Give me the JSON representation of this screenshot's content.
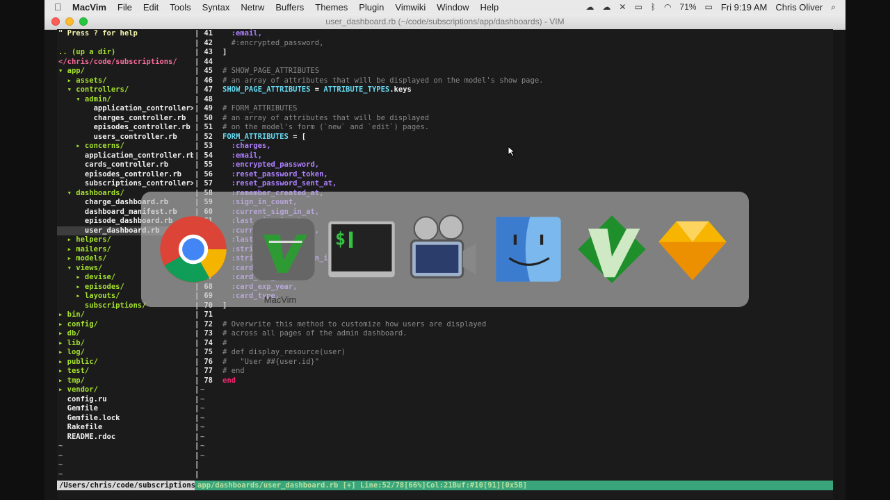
{
  "menubar": {
    "app_name": "MacVim",
    "items": [
      "File",
      "Edit",
      "Tools",
      "Syntax",
      "Netrw",
      "Buffers",
      "Themes",
      "Plugin",
      "Vimwiki",
      "Window",
      "Help"
    ],
    "battery": "71%",
    "clock": "Fri 9:19 AM",
    "user": "Chris Oliver"
  },
  "window": {
    "title": "user_dashboard.rb (~/code/subscriptions/app/dashboards) - VIM"
  },
  "tree": {
    "lines": [
      {
        "text": "\" Press ? for help",
        "cls": "help"
      },
      {
        "text": "",
        "cls": "file"
      },
      {
        "text": ".. (up a dir)",
        "cls": "dir2"
      },
      {
        "text": "</chris/code/subscriptions/",
        "cls": "dir"
      },
      {
        "text": "▾ app/",
        "cls": "dir2"
      },
      {
        "text": "  ▸ assets/",
        "cls": "dir2"
      },
      {
        "text": "  ▾ controllers/",
        "cls": "dir2"
      },
      {
        "text": "    ▾ admin/",
        "cls": "dir2"
      },
      {
        "text": "        application_controller>",
        "cls": "file"
      },
      {
        "text": "        charges_controller.rb",
        "cls": "file"
      },
      {
        "text": "        episodes_controller.rb",
        "cls": "file"
      },
      {
        "text": "        users_controller.rb",
        "cls": "file"
      },
      {
        "text": "    ▸ concerns/",
        "cls": "dir2"
      },
      {
        "text": "      application_controller.rb",
        "cls": "file"
      },
      {
        "text": "      cards_controller.rb",
        "cls": "file"
      },
      {
        "text": "      episodes_controller.rb",
        "cls": "file"
      },
      {
        "text": "      subscriptions_controller>",
        "cls": "file"
      },
      {
        "text": "  ▾ dashboards/",
        "cls": "dir2"
      },
      {
        "text": "      charge_dashboard.rb",
        "cls": "file"
      },
      {
        "text": "      dashboard_manifest.rb",
        "cls": "file"
      },
      {
        "text": "      episode_dashboard.rb",
        "cls": "file"
      },
      {
        "text": "      user_dashboard.rb",
        "cls": "file sel"
      },
      {
        "text": "  ▸ helpers/",
        "cls": "dir2"
      },
      {
        "text": "  ▸ mailers/",
        "cls": "dir2"
      },
      {
        "text": "  ▸ models/",
        "cls": "dir2"
      },
      {
        "text": "  ▾ views/",
        "cls": "dir2"
      },
      {
        "text": "    ▸ devise/",
        "cls": "dir2"
      },
      {
        "text": "    ▸ episodes/",
        "cls": "dir2"
      },
      {
        "text": "    ▸ layouts/",
        "cls": "dir2"
      },
      {
        "text": "      subscriptions/",
        "cls": "dir2"
      },
      {
        "text": "▸ bin/",
        "cls": "dir2"
      },
      {
        "text": "▸ config/",
        "cls": "dir2"
      },
      {
        "text": "▸ db/",
        "cls": "dir2"
      },
      {
        "text": "▸ lib/",
        "cls": "dir2"
      },
      {
        "text": "▸ log/",
        "cls": "dir2"
      },
      {
        "text": "▸ public/",
        "cls": "dir2"
      },
      {
        "text": "▸ test/",
        "cls": "dir2"
      },
      {
        "text": "▸ tmp/",
        "cls": "dir2"
      },
      {
        "text": "▸ vendor/",
        "cls": "dir2"
      },
      {
        "text": "  config.ru",
        "cls": "file"
      },
      {
        "text": "  Gemfile",
        "cls": "file"
      },
      {
        "text": "  Gemfile.lock",
        "cls": "file"
      },
      {
        "text": "  Rakefile",
        "cls": "file"
      },
      {
        "text": "  README.rdoc",
        "cls": "file"
      },
      {
        "text": "~",
        "cls": "tilde"
      },
      {
        "text": "~",
        "cls": "tilde"
      },
      {
        "text": "~",
        "cls": "tilde"
      },
      {
        "text": "~",
        "cls": "tilde"
      }
    ]
  },
  "code": {
    "lines": [
      {
        "n": "41",
        "parts": [
          [
            "  ",
            "plain"
          ],
          [
            ":email,",
            "sym"
          ]
        ]
      },
      {
        "n": "42",
        "parts": [
          [
            "  #:encrypted_password,",
            "cmt"
          ]
        ]
      },
      {
        "n": "43",
        "parts": [
          [
            "]",
            "plain"
          ]
        ]
      },
      {
        "n": "44",
        "parts": []
      },
      {
        "n": "45",
        "parts": [
          [
            "# SHOW_PAGE_ATTRIBUTES",
            "cmt"
          ]
        ]
      },
      {
        "n": "46",
        "parts": [
          [
            "# an array of attributes that will be displayed on the model's show page.",
            "cmt"
          ]
        ]
      },
      {
        "n": "47",
        "parts": [
          [
            "SHOW_PAGE_ATTRIBUTES",
            "const"
          ],
          [
            " = ",
            "plain"
          ],
          [
            "ATTRIBUTE_TYPES",
            "const"
          ],
          [
            ".keys",
            "plain"
          ]
        ]
      },
      {
        "n": "48",
        "parts": []
      },
      {
        "n": "49",
        "parts": [
          [
            "# FORM_ATTRIBUTES",
            "cmt"
          ]
        ]
      },
      {
        "n": "50",
        "parts": [
          [
            "# an array of attributes that will be displayed",
            "cmt"
          ]
        ]
      },
      {
        "n": "51",
        "parts": [
          [
            "# on the model's form (`new` and `edit`) pages.",
            "cmt"
          ]
        ]
      },
      {
        "n": "52",
        "parts": [
          [
            "FORM_ATTRIBUTES",
            "const"
          ],
          [
            " = ",
            "plain"
          ],
          [
            "[",
            "plain"
          ]
        ]
      },
      {
        "n": "53",
        "parts": [
          [
            "  ",
            "plain"
          ],
          [
            ":charges,",
            "sym"
          ]
        ]
      },
      {
        "n": "54",
        "parts": [
          [
            "  ",
            "plain"
          ],
          [
            ":email,",
            "sym"
          ]
        ]
      },
      {
        "n": "55",
        "parts": [
          [
            "  ",
            "plain"
          ],
          [
            ":encrypted_password,",
            "sym"
          ]
        ]
      },
      {
        "n": "56",
        "parts": [
          [
            "  ",
            "plain"
          ],
          [
            ":reset_password_token,",
            "sym"
          ]
        ]
      },
      {
        "n": "57",
        "parts": [
          [
            "  ",
            "plain"
          ],
          [
            ":reset_password_sent_at,",
            "sym"
          ]
        ]
      },
      {
        "n": "58",
        "parts": [
          [
            "  ",
            "plain"
          ],
          [
            ":remember_created_at,",
            "sym"
          ]
        ]
      },
      {
        "n": "59",
        "parts": [
          [
            "  ",
            "plain"
          ],
          [
            ":sign_in_count,",
            "sym"
          ]
        ]
      },
      {
        "n": "60",
        "parts": [
          [
            "  ",
            "plain"
          ],
          [
            ":current_sign_in_at,",
            "sym"
          ]
        ]
      },
      {
        "n": "61",
        "parts": [
          [
            "  ",
            "plain"
          ],
          [
            ":last_sign_in_at,",
            "sym"
          ]
        ]
      },
      {
        "n": "62",
        "parts": [
          [
            "  ",
            "plain"
          ],
          [
            ":current_sign_in_ip,",
            "sym"
          ]
        ]
      },
      {
        "n": "63",
        "parts": [
          [
            "  ",
            "plain"
          ],
          [
            ":last_sign_in_ip,",
            "sym"
          ]
        ]
      },
      {
        "n": "64",
        "parts": [
          [
            "  ",
            "plain"
          ],
          [
            ":stripe_id,",
            "sym"
          ]
        ]
      },
      {
        "n": "65",
        "parts": [
          [
            "  ",
            "plain"
          ],
          [
            ":stripe_subscription_id,",
            "sym"
          ]
        ]
      },
      {
        "n": "66",
        "parts": [
          [
            "  ",
            "plain"
          ],
          [
            ":card_last4,",
            "sym"
          ]
        ]
      },
      {
        "n": "67",
        "parts": [
          [
            "  ",
            "plain"
          ],
          [
            ":card_exp_month,",
            "sym"
          ]
        ]
      },
      {
        "n": "68",
        "parts": [
          [
            "  ",
            "plain"
          ],
          [
            ":card_exp_year,",
            "sym"
          ]
        ]
      },
      {
        "n": "69",
        "parts": [
          [
            "  ",
            "plain"
          ],
          [
            ":card_type,",
            "sym"
          ]
        ]
      },
      {
        "n": "70",
        "parts": [
          [
            "]",
            "plain"
          ]
        ]
      },
      {
        "n": "71",
        "parts": []
      },
      {
        "n": "72",
        "parts": [
          [
            "# Overwrite this method to customize how users are displayed",
            "cmt"
          ]
        ]
      },
      {
        "n": "73",
        "parts": [
          [
            "# across all pages of the admin dashboard.",
            "cmt"
          ]
        ]
      },
      {
        "n": "74",
        "parts": [
          [
            "#",
            "cmt"
          ]
        ]
      },
      {
        "n": "75",
        "parts": [
          [
            "# def display_resource(user)",
            "cmt"
          ]
        ]
      },
      {
        "n": "76",
        "parts": [
          [
            "#   \"User ##{user.id}\"",
            "cmt"
          ]
        ]
      },
      {
        "n": "77",
        "parts": [
          [
            "# end",
            "cmt"
          ]
        ]
      },
      {
        "n": "78",
        "parts": [
          [
            "end",
            "kw"
          ]
        ]
      }
    ],
    "empty_tildes": 8
  },
  "statusline": {
    "cwd": "/Users/chris/code/subscriptions",
    "info": "app/dashboards/user_dashboard.rb [+] Line:52/78[66%]Col:21Buf:#10[91][0x5B]"
  },
  "app_switcher": {
    "selected_label": "MacVim",
    "apps": [
      "chrome-icon",
      "macvim-icon",
      "terminal-icon",
      "screenflow-icon",
      "finder-icon",
      "vim-icon",
      "sketch-icon"
    ]
  }
}
